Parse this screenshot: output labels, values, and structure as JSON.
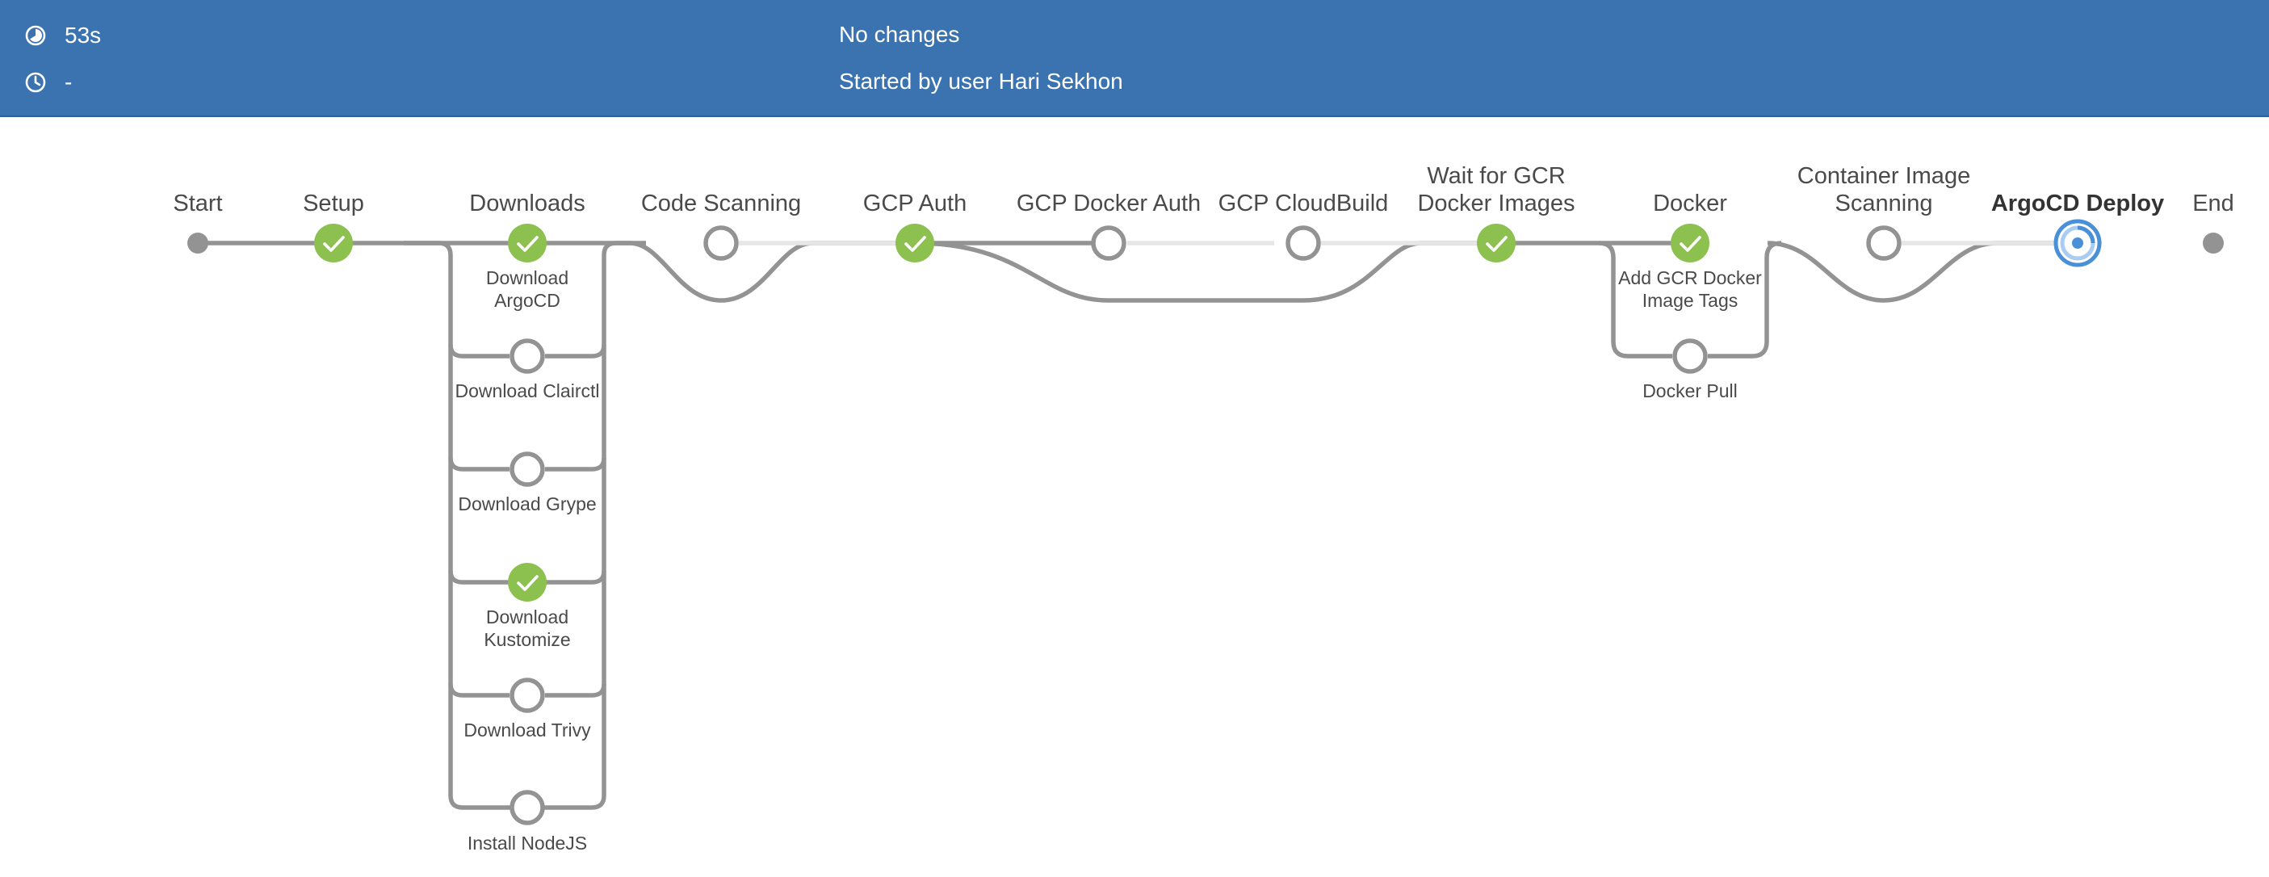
{
  "header": {
    "duration": "53s",
    "duration_icon": "timer-icon",
    "start_time": "-",
    "start_icon": "clock-icon",
    "changes": "No changes",
    "cause": "Started by user Hari Sekhon"
  },
  "colors": {
    "header_bg": "#3b73b0",
    "success": "#8cc04f",
    "pending": "#949393",
    "running": "#4a90d9",
    "connector": "#949393"
  },
  "pipeline": {
    "stages": [
      {
        "id": "start",
        "label": "Start",
        "status": "terminal"
      },
      {
        "id": "setup",
        "label": "Setup",
        "status": "success"
      },
      {
        "id": "downloads",
        "label": "Downloads",
        "status": "success",
        "parallel": true
      },
      {
        "id": "code-scanning",
        "label": "Code Scanning",
        "status": "not-built"
      },
      {
        "id": "gcp-auth",
        "label": "GCP Auth",
        "status": "success"
      },
      {
        "id": "gcp-docker-auth",
        "label": "GCP Docker Auth",
        "status": "not-built"
      },
      {
        "id": "gcp-cloudbuild",
        "label": "GCP CloudBuild",
        "status": "not-built"
      },
      {
        "id": "wait-gcr",
        "label": "Wait for GCR",
        "label2": "Docker Images",
        "status": "success"
      },
      {
        "id": "docker",
        "label": "Docker",
        "status": "success",
        "parallel": true
      },
      {
        "id": "container-image-scanning",
        "label": "Container Image",
        "label2": "Scanning",
        "status": "not-built"
      },
      {
        "id": "argocd-deploy",
        "label": "ArgoCD Deploy",
        "status": "running",
        "current": true
      },
      {
        "id": "end",
        "label": "End",
        "status": "terminal"
      }
    ],
    "downloads_branches": [
      {
        "label": "Download",
        "label2": "ArgoCD",
        "status": "success"
      },
      {
        "label": "Download Clairctl",
        "status": "not-built"
      },
      {
        "label": "Download Grype",
        "status": "not-built"
      },
      {
        "label": "Download",
        "label2": "Kustomize",
        "status": "success"
      },
      {
        "label": "Download Trivy",
        "status": "not-built"
      },
      {
        "label": "Install NodeJS",
        "status": "not-built"
      }
    ],
    "docker_branches": [
      {
        "label": "Add GCR Docker",
        "label2": "Image Tags",
        "status": "success"
      },
      {
        "label": "Docker Pull",
        "status": "not-built"
      }
    ]
  }
}
